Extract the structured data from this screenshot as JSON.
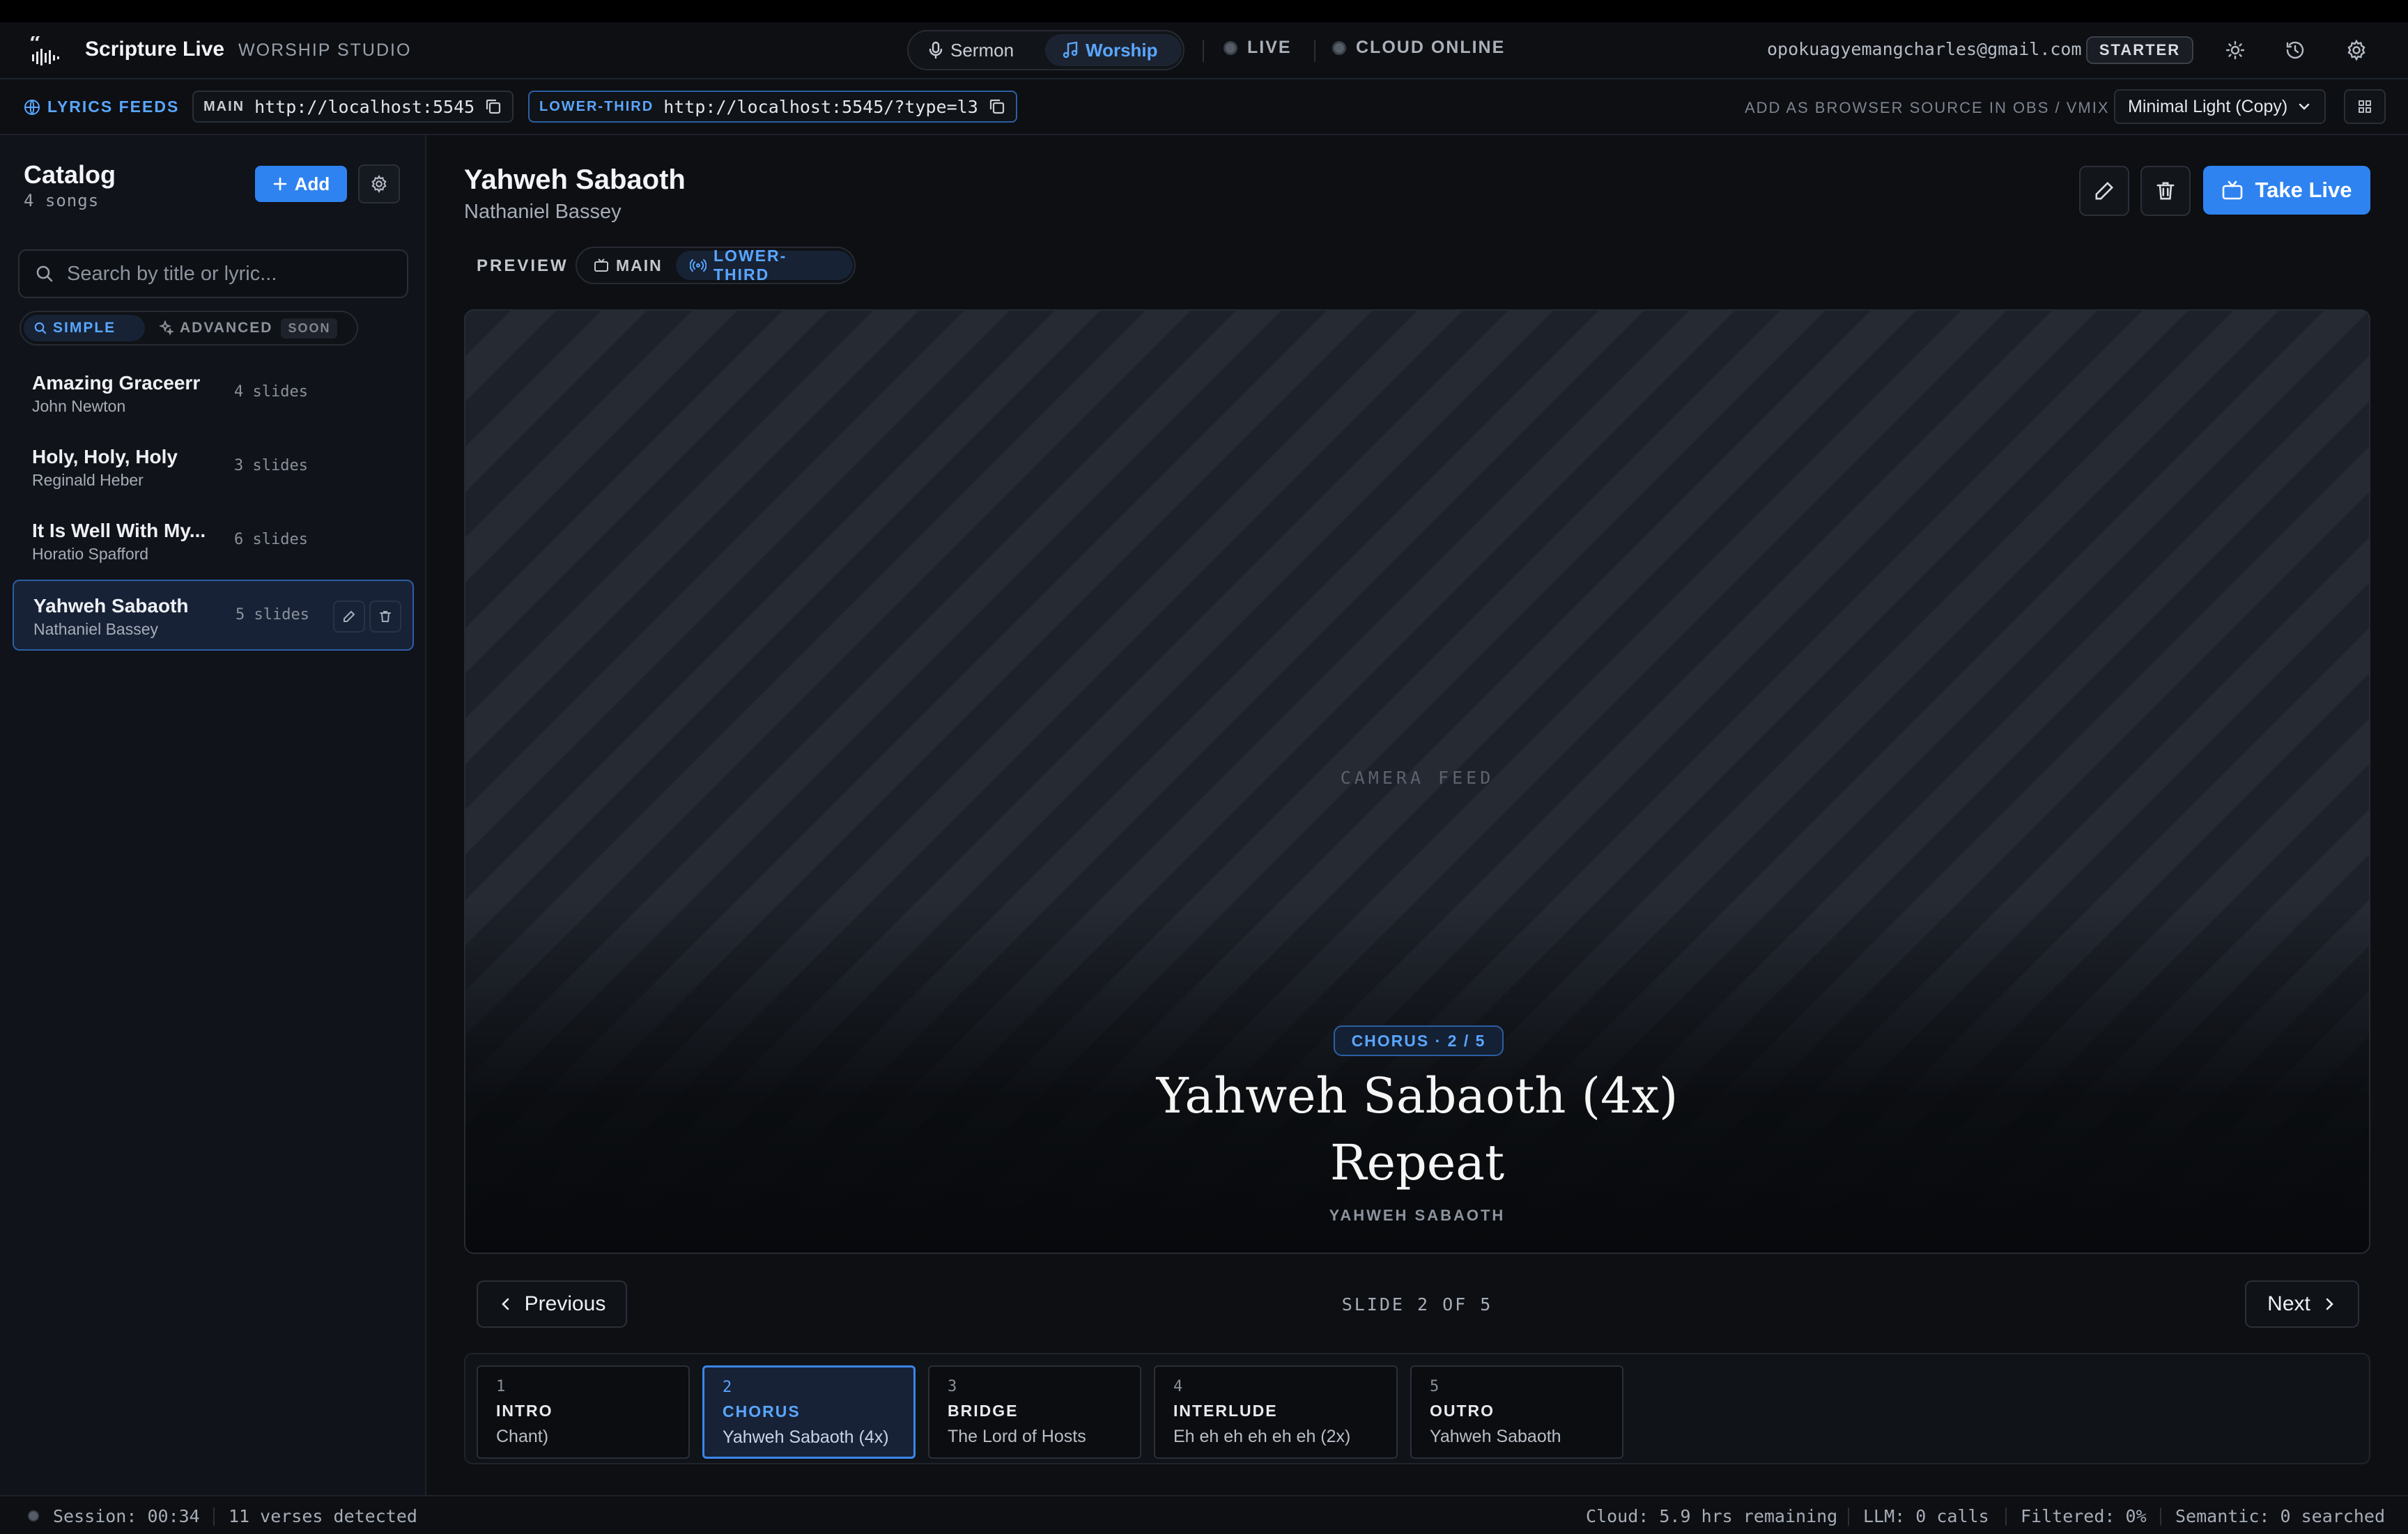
{
  "app": {
    "title": "Scripture Live",
    "subtitle": "WORSHIP STUDIO"
  },
  "modes": [
    {
      "label": "Sermon",
      "icon": "mic-icon",
      "active": false
    },
    {
      "label": "Worship",
      "icon": "music-note-icon",
      "active": true
    }
  ],
  "status": {
    "live": "LIVE",
    "cloud": "CLOUD ONLINE"
  },
  "user": {
    "email": "opokuagyemangcharles@gmail.com",
    "plan": "STARTER"
  },
  "feeds": {
    "label": "LYRICS FEEDS",
    "main_key": "MAIN",
    "main_url": "http://localhost:5545",
    "l3_key": "LOWER-THIRD",
    "l3_url": "http://localhost:5545/?type=l3",
    "hint": "ADD AS BROWSER SOURCE IN OBS / VMIX",
    "theme": "Minimal Light (Copy)"
  },
  "catalog": {
    "title": "Catalog",
    "count": "4  songs",
    "add_label": "Add",
    "search_placeholder": "Search by title or lyric...",
    "mode_simple": "SIMPLE",
    "mode_advanced": "ADVANCED",
    "mode_soon": "SOON",
    "songs": [
      {
        "title": "Amazing Graceerr",
        "artist": "John Newton",
        "slides": "4 slides"
      },
      {
        "title": "Holy, Holy, Holy",
        "artist": "Reginald Heber",
        "slides": "3 slides"
      },
      {
        "title": "It Is Well With My...",
        "artist": "Horatio Spafford",
        "slides": "6 slides"
      },
      {
        "title": "Yahweh Sabaoth",
        "artist": "Nathaniel Bassey",
        "slides": "5 slides"
      }
    ]
  },
  "song": {
    "title": "Yahweh Sabaoth",
    "artist": "Nathaniel Bassey",
    "take_live": "Take Live"
  },
  "preview": {
    "label": "PREVIEW",
    "main": "MAIN",
    "lower_third": "LOWER-THIRD",
    "camera": "CAMERA FEED",
    "chip": "CHORUS · 2 / 5",
    "line1": "Yahweh Sabaoth (4x)",
    "line2": "Repeat",
    "caption": "YAHWEH SABAOTH"
  },
  "navigation": {
    "previous": "Previous",
    "next": "Next",
    "counter": "SLIDE 2 OF 5"
  },
  "slides": [
    {
      "num": "1",
      "label": "INTRO",
      "text": "Chant)"
    },
    {
      "num": "2",
      "label": "CHORUS",
      "text": "Yahweh Sabaoth (4x)"
    },
    {
      "num": "3",
      "label": "BRIDGE",
      "text": "The Lord of Hosts"
    },
    {
      "num": "4",
      "label": "INTERLUDE",
      "text": "Eh eh eh eh eh eh (2x)"
    },
    {
      "num": "5",
      "label": "OUTRO",
      "text": "Yahweh Sabaoth"
    }
  ],
  "footer": {
    "session": "Session: 00:34",
    "verses": "11 verses detected",
    "cloud": "Cloud: 5.9 hrs remaining",
    "llm": "LLM: 0 calls",
    "filtered": "Filtered: 0%",
    "semantic": "Semantic: 0 searched"
  },
  "colors": {
    "accent": "#2f83f0",
    "accent_text": "#5aa6ff",
    "background": "#0c0e12"
  }
}
